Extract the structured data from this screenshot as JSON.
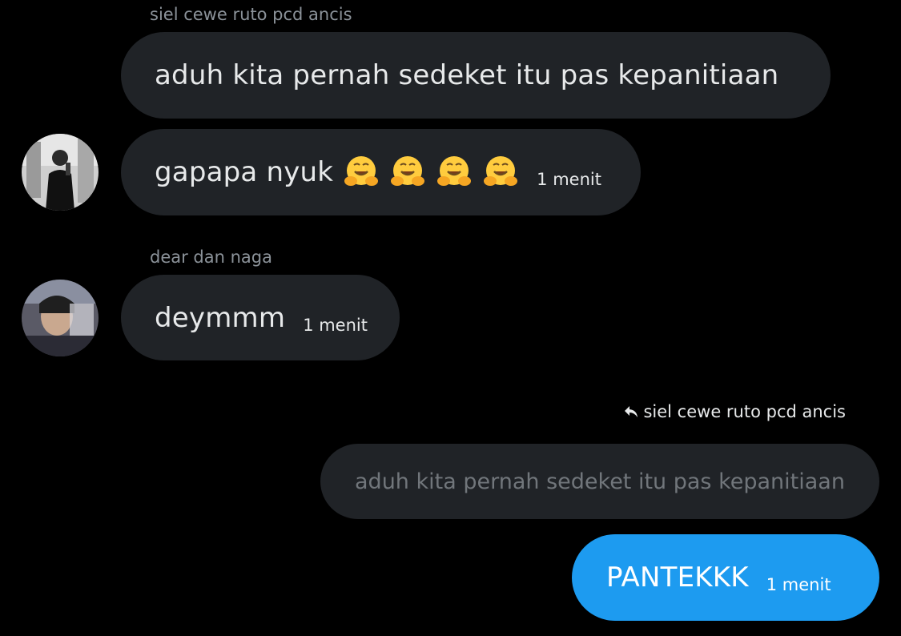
{
  "messages": [
    {
      "sender": "siel cewe ruto pcd ancis",
      "text": "aduh kita pernah sedeket itu pas kepanitiaan"
    },
    {
      "text": "gapapa nyuk",
      "emoji": [
        "hugging-face",
        "hugging-face",
        "hugging-face",
        "hugging-face"
      ],
      "time": "1 menit"
    },
    {
      "sender": "dear dan naga",
      "text": "deymmm",
      "time": "1 menit"
    }
  ],
  "own_message": {
    "reply_to": "siel cewe ruto pcd ancis",
    "quoted_text": "aduh kita pernah sedeket itu pas kepanitiaan",
    "text": "PANTEKKK",
    "time": "1 menit"
  },
  "colors": {
    "background": "#000000",
    "bubble_incoming": "#202327",
    "bubble_own": "#1d9bf0",
    "muted_text": "#8b9299"
  }
}
